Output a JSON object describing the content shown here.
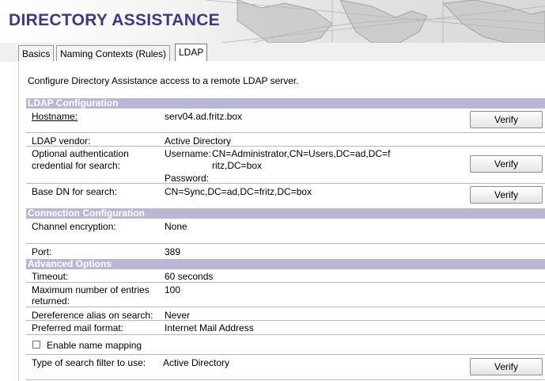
{
  "header": {
    "title": "DIRECTORY ASSISTANCE"
  },
  "tabs": [
    {
      "label": "Basics",
      "active": false
    },
    {
      "label": "Naming Contexts (Rules)",
      "active": false
    },
    {
      "label": "LDAP",
      "active": true
    }
  ],
  "intro": "Configure Directory Assistance access to a remote LDAP server.",
  "ldap_config": {
    "section_title": "LDAP Configuration",
    "hostname_label": "Hostname:",
    "hostname_value": "serv04.ad.fritz.box",
    "vendor_label": "LDAP vendor:",
    "vendor_value": "Active Directory",
    "auth_label_line1": "Optional authentication",
    "auth_label_line2": "credential for search:",
    "username_label": "Username:",
    "username_value_line1": "CN=Administrator,CN=Users,DC=ad,DC=f",
    "username_value_line2": "ritz,DC=box",
    "password_label": "Password:",
    "basedn_label": "Base DN for search:",
    "basedn_value": "CN=Sync,DC=ad,DC=fritz,DC=box"
  },
  "connection_config": {
    "section_title": "Connection Configuration",
    "encryption_label": "Channel encryption:",
    "encryption_value": "None",
    "port_label": "Port:",
    "port_value": "389"
  },
  "advanced_options": {
    "section_title": "Advanced Options",
    "timeout_label": "Timeout:",
    "timeout_value": "60 seconds",
    "maxentries_label_line1": "Maximum number of entries",
    "maxentries_label_line2": "returned:",
    "maxentries_value": "100",
    "deref_label": "Dereference alias on search:",
    "deref_value": "Never",
    "mailformat_label": "Preferred mail format:",
    "mailformat_value": "Internet Mail Address",
    "namemapping_label": "Enable name mapping",
    "namemapping_checked": false,
    "filter_label": "Type of search filter to use:",
    "filter_value": "Active Directory"
  },
  "buttons": {
    "verify_label": "Verify"
  }
}
